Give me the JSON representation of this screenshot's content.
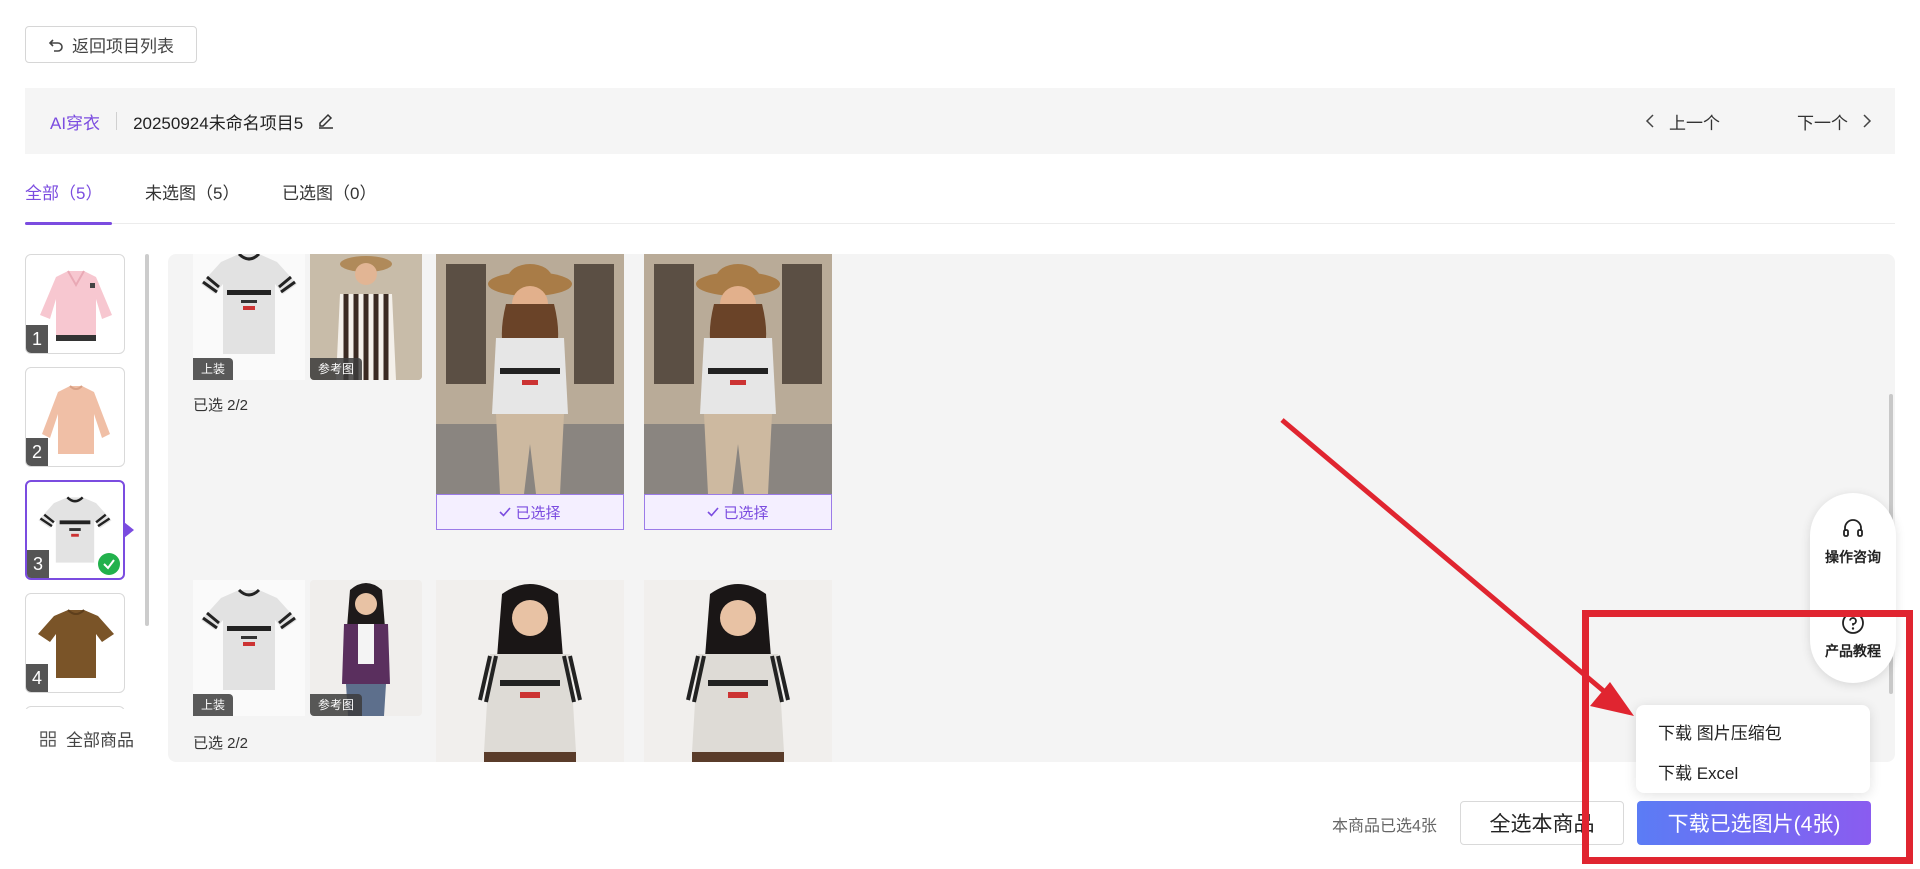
{
  "header": {
    "back_label": "返回项目列表"
  },
  "project": {
    "type": "AI穿衣",
    "name": "20250924未命名项目5",
    "prev_label": "上一个",
    "next_label": "下一个"
  },
  "tabs": [
    {
      "label": "全部（5）",
      "active": true
    },
    {
      "label": "未选图（5）",
      "active": false
    },
    {
      "label": "已选图（0）",
      "active": false
    }
  ],
  "thumbnails": [
    {
      "num": "1",
      "garment": "pink-sweater",
      "selected": false
    },
    {
      "num": "2",
      "garment": "peach-longsleeve",
      "selected": false
    },
    {
      "num": "3",
      "garment": "grey-tshirt",
      "selected": true
    },
    {
      "num": "4",
      "garment": "brown-tshirt",
      "selected": false
    }
  ],
  "all_products_label": "全部商品",
  "groups": [
    {
      "top_tag": "上装",
      "ref_tag": "参考图",
      "count_label": "已选 2/2",
      "results": [
        {
          "status": "已选择"
        },
        {
          "status": "已选择"
        }
      ]
    },
    {
      "top_tag": "上装",
      "ref_tag": "参考图",
      "count_label": "已选 2/2",
      "results": [
        {
          "status": ""
        },
        {
          "status": ""
        }
      ]
    }
  ],
  "float_panel": {
    "consult_label": "操作咨询",
    "tutorial_label": "产品教程"
  },
  "download_menu": {
    "zip_label": "下载 图片压缩包",
    "excel_label": "下载 Excel"
  },
  "footer": {
    "selected_info": "本商品已选4张",
    "select_all_label": "全选本商品",
    "download_label": "下载已选图片(4张)"
  },
  "colors": {
    "accent": "#7b4ce0",
    "download_gradient_start": "#5b7cf5",
    "download_gradient_end": "#8a5cf0",
    "annotation_red": "#e02530",
    "check_green": "#22b14c"
  }
}
